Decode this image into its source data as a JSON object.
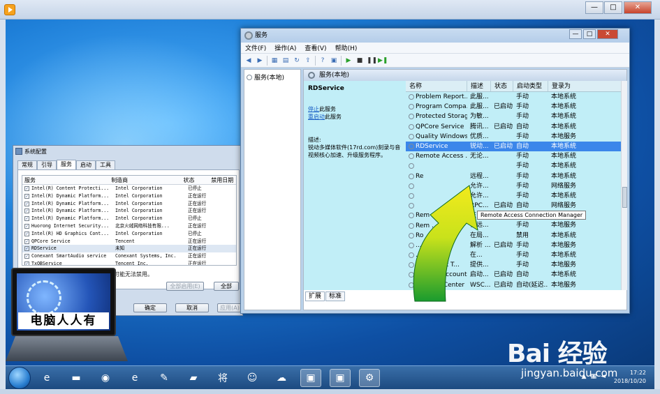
{
  "player": {
    "controls": {
      "minimize": "—",
      "maximize": "□",
      "close": "✕"
    }
  },
  "services_window": {
    "title": "服务",
    "menus": [
      "文件(F)",
      "操作(A)",
      "查看(V)",
      "帮助(H)"
    ],
    "tree_node": "服务(本地)",
    "pane_header": "服务(本地)",
    "selected_service": {
      "name": "RDService",
      "stop_link": "停止",
      "stop_text": "此服务",
      "restart_link": "重启动",
      "restart_text": "此服务",
      "desc_label": "描述:",
      "description": "锐动多媒体软件(17rd.com)刻录与音视频核心加速、升级服务程序。"
    },
    "columns": [
      "名称",
      "描述",
      "状态",
      "启动类型",
      "登录为"
    ],
    "rows": [
      [
        "Problem Report...",
        "此服...",
        "",
        "手动",
        "本地系统"
      ],
      [
        "Program Compa...",
        "此服...",
        "已启动",
        "手动",
        "本地系统"
      ],
      [
        "Protected Storage",
        "为敏...",
        "",
        "手动",
        "本地系统"
      ],
      [
        "QPCore Service",
        "腾讯...",
        "已启动",
        "自动",
        "本地系统"
      ],
      [
        "Quality Windows...",
        "优质...",
        "",
        "手动",
        "本地服务"
      ],
      [
        "RDService",
        "锐动...",
        "已启动",
        "自动",
        "本地系统"
      ],
      [
        "Remote Access ...",
        "无论...",
        "",
        "手动",
        "本地系统"
      ],
      [
        "",
        "",
        "",
        "手动",
        "本地系统"
      ],
      [
        "Re",
        "远程...",
        "",
        "手动",
        "本地系统"
      ],
      [
        "",
        "允许...",
        "",
        "手动",
        "网络服务"
      ],
      [
        "",
        "允许...",
        "",
        "手动",
        "本地系统"
      ],
      [
        "",
        "RPC...",
        "已启动",
        "自动",
        "网络服务"
      ],
      [
        "Rem",
        "在 W...",
        "",
        "手动",
        "网络服务"
      ],
      [
        "Rem ...stry",
        "使远...",
        "",
        "手动",
        "本地服务"
      ],
      [
        "Ro",
        "在局...",
        "",
        "禁用",
        "本地系统"
      ],
      [
        "...oint M...",
        "解析 ...",
        "已启动",
        "手动",
        "本地服务"
      ],
      [
        "...re Logon",
        "在...",
        "",
        "手动",
        "本地系统"
      ],
      [
        "...e Socket T...",
        "提供...",
        "",
        "手动",
        "本地服务"
      ],
      [
        "...curity Account...",
        "启动...",
        "已启动",
        "自动",
        "本地系统"
      ],
      [
        "Security Center",
        "WSC...",
        "已启动",
        "自动(延迟...",
        "本地服务"
      ]
    ],
    "tooltip": "Remote Access Connection Manager",
    "tabs": [
      "扩展",
      "标准"
    ]
  },
  "config_window": {
    "title": "系统配置",
    "tabs": [
      "常规",
      "引导",
      "服务",
      "启动",
      "工具"
    ],
    "columns": [
      "服务",
      "制造商",
      "状态",
      "禁用日期"
    ],
    "rows": [
      [
        "Intel(R) Content Protecti...",
        "Intel Corporation",
        "已停止"
      ],
      [
        "Intel(R) Dynamic Platform...",
        "Intel Corporation",
        "正在运行"
      ],
      [
        "Intel(R) Dynamic Platform...",
        "Intel Corporation",
        "正在运行"
      ],
      [
        "Intel(R) Dynamic Platform...",
        "Intel Corporation",
        "正在运行"
      ],
      [
        "Intel(R) Dynamic Platform...",
        "Intel Corporation",
        "已停止"
      ],
      [
        "Huorong Internet Security...",
        "北京火绒网络科技有限...",
        "正在运行"
      ],
      [
        "Intel(R) HD Graphics Cont...",
        "Intel Corporation",
        "已停止"
      ],
      [
        "QPCore Service",
        "Tencent",
        "正在运行"
      ],
      [
        "RDService",
        "未知",
        "正在运行"
      ],
      [
        "Conexant SmartAudio service",
        "Conexant Systems, Inc.",
        "正在运行"
      ],
      [
        "TxQBService",
        "Tencent Inc.",
        "正在运行"
      ]
    ],
    "note": "可能无法禁用。",
    "btn_enable_all": "全部启用(E)",
    "btn_disable_all": "全部",
    "btn_ok": "确定",
    "btn_cancel": "取消",
    "btn_apply": "应用(A)"
  },
  "logo_text": "电脑人人有",
  "taskbar": {
    "items": [
      "ie",
      "folder",
      "media",
      "ie2",
      "paint",
      "stickynote",
      "jiang",
      "game",
      "cloud",
      "monitor1",
      "monitor2",
      "services"
    ],
    "time": "17:22",
    "date": "2018/10/20"
  },
  "watermark": {
    "brand": "Bai 经验",
    "url": "jingyan.baidu.com"
  }
}
